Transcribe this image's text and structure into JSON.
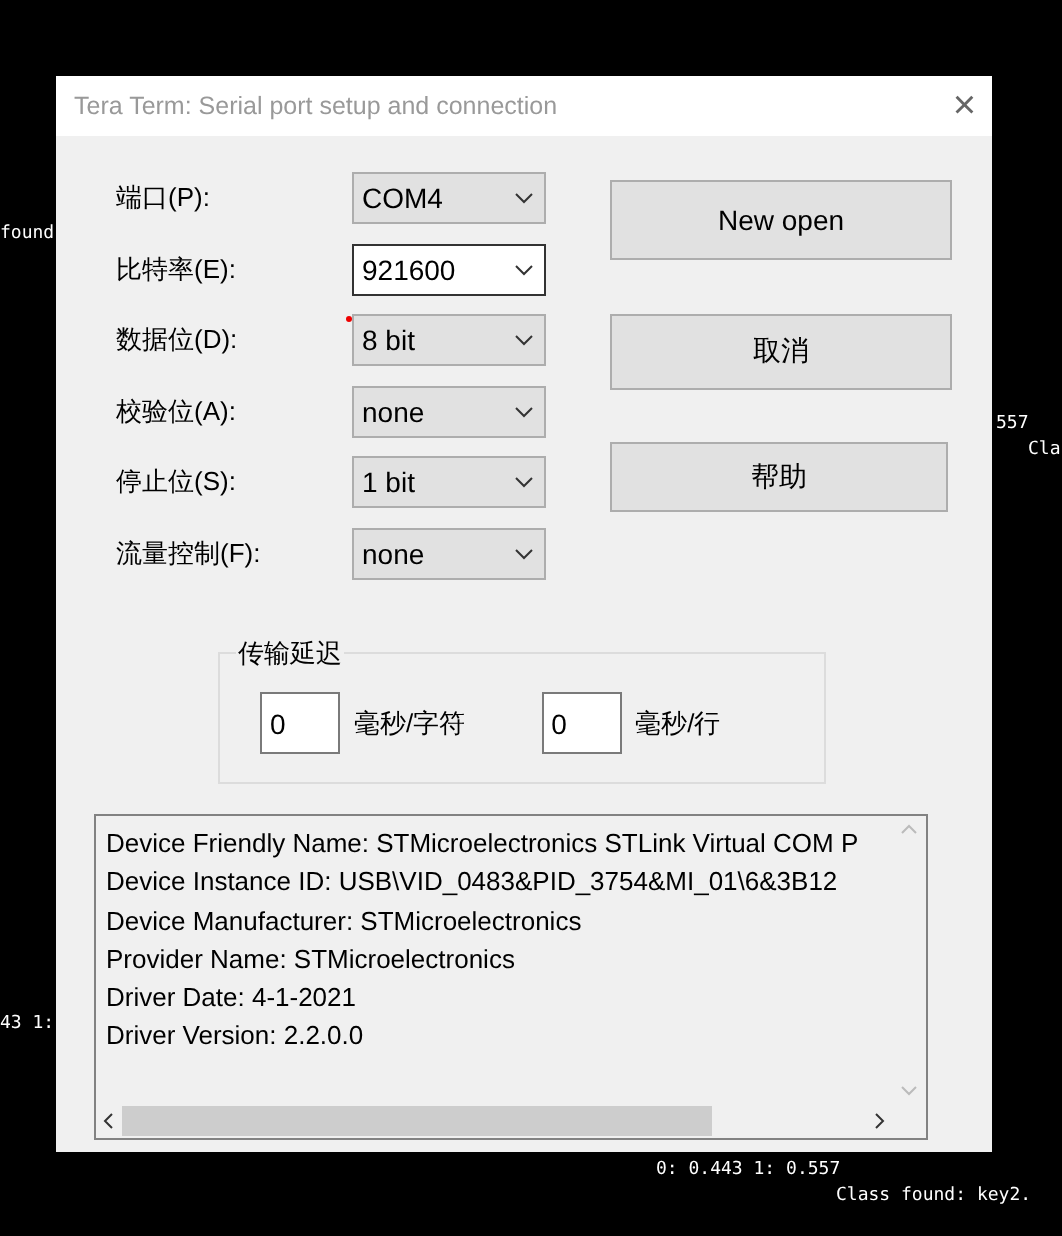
{
  "background_text": [
    "found",
    "557",
    "Cla",
    "43 1:",
    "0: 0.443 1: 0.557",
    "Class found: key2."
  ],
  "window": {
    "title": "Tera Term: Serial port setup and connection",
    "close": "×"
  },
  "fields": [
    {
      "label": "端口(P):",
      "value": "COM4",
      "focused": false,
      "marked": false
    },
    {
      "label": "比特率(E):",
      "value": "921600",
      "focused": true,
      "marked": false
    },
    {
      "label": "数据位(D):",
      "value": "8 bit",
      "focused": false,
      "marked": true
    },
    {
      "label": "校验位(A):",
      "value": "none",
      "focused": false,
      "marked": false
    },
    {
      "label": "停止位(S):",
      "value": "1 bit",
      "focused": false,
      "marked": false
    },
    {
      "label": "流量控制(F):",
      "value": "none",
      "focused": false,
      "marked": false
    }
  ],
  "buttons": [
    "New open",
    "取消",
    "帮助"
  ],
  "transmit_delay": {
    "title": "传输延迟",
    "per_char": {
      "value": "0",
      "unit": "毫秒/字符"
    },
    "per_line": {
      "value": "0",
      "unit": "毫秒/行"
    }
  },
  "device_info": [
    "Device Friendly Name: STMicroelectronics STLink Virtual COM P",
    "Device Instance ID: USB\\VID_0483&PID_3754&MI_01\\6&3B12",
    "Device Manufacturer: STMicroelectronics",
    "Provider Name: STMicroelectronics",
    "Driver Date: 4-1-2021",
    "Driver Version: 2.2.0.0"
  ]
}
